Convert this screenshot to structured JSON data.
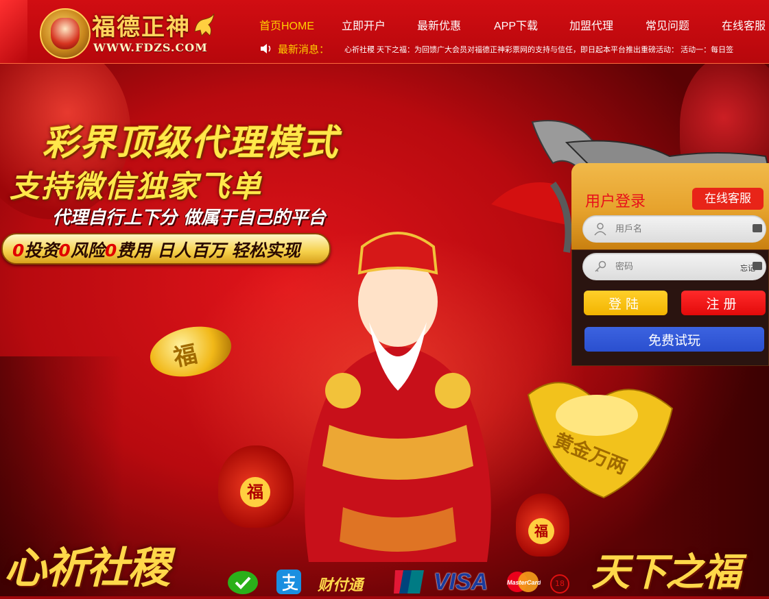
{
  "brand": {
    "name": "福德正神",
    "url": "WWW.FDZS.COM"
  },
  "nav": {
    "items": [
      {
        "label": "首页HOME",
        "active": true
      },
      {
        "label": "立即开户",
        "active": false
      },
      {
        "label": "最新优惠",
        "active": false
      },
      {
        "label": "APP下载",
        "active": false
      },
      {
        "label": "加盟代理",
        "active": false
      },
      {
        "label": "常见问题",
        "active": false
      },
      {
        "label": "在线客服",
        "active": false
      }
    ]
  },
  "notice": {
    "label": "最新消息：",
    "text": "心祈社稷 天下之福：为回馈广大会员对福德正神彩票网的支持与信任，即日起本平台推出重磅活动：  活动一：每日签"
  },
  "banner": {
    "line1": "彩界顶级代理模式",
    "line2": "支持微信独家飞单",
    "line3": "代理自行上下分 做属于自己的平台",
    "pill_parts": [
      "0",
      "投资",
      "0",
      "风险",
      "0",
      "费用 日人百万 轻松实现"
    ],
    "coin_char": "福",
    "bag_char": "福",
    "ingot_text": "黄金万两",
    "calligraphy_left": "心祈社稷",
    "calligraphy_right": "天下之福"
  },
  "login": {
    "title": "用户登录",
    "customer_service": "在线客服",
    "username_placeholder": "用戶名",
    "password_placeholder": "密码",
    "forgot": "忘记",
    "login_button": "登陆",
    "register_button": "注册",
    "trial_button": "免费试玩"
  },
  "payments": {
    "tenpay": "财付通",
    "visa": "VISA",
    "mastercard": "MasterCard",
    "age": "18"
  },
  "colors": {
    "primary_red": "#d10d12",
    "gold": "#ffd000",
    "login_yellow": "#f2b400",
    "register_red": "#e30a0a",
    "trial_blue": "#2a4fcf"
  }
}
